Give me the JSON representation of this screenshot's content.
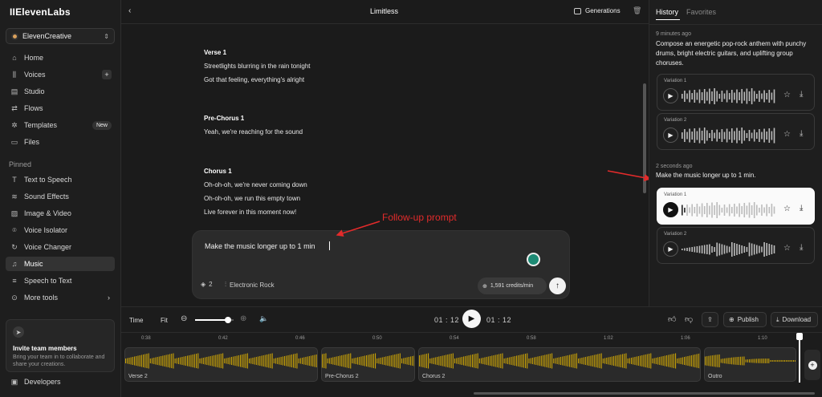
{
  "app": {
    "logo": "IIElevenLabs",
    "workspace": "ElevenCreative"
  },
  "sidebar": {
    "items": [
      {
        "label": "Home",
        "icon": "home-icon"
      },
      {
        "label": "Voices",
        "icon": "voices-icon",
        "extra": "+"
      },
      {
        "label": "Studio",
        "icon": "studio-icon"
      },
      {
        "label": "Flows",
        "icon": "flows-icon"
      },
      {
        "label": "Templates",
        "icon": "templates-icon",
        "badge": "New"
      },
      {
        "label": "Files",
        "icon": "files-icon"
      }
    ],
    "pinned_label": "Pinned",
    "pinned": [
      {
        "label": "Text to Speech",
        "icon": "tts-icon"
      },
      {
        "label": "Sound Effects",
        "icon": "sfx-icon"
      },
      {
        "label": "Image & Video",
        "icon": "image-icon"
      },
      {
        "label": "Voice Isolator",
        "icon": "isolator-icon"
      },
      {
        "label": "Voice Changer",
        "icon": "changer-icon"
      },
      {
        "label": "Music",
        "icon": "music-icon",
        "active": true
      },
      {
        "label": "Speech to Text",
        "icon": "stt-icon"
      },
      {
        "label": "More tools",
        "icon": "more-icon"
      }
    ],
    "invite": {
      "title": "Invite team members",
      "desc": "Bring your team in to collaborate and share your creations."
    },
    "developers": "Developers"
  },
  "topbar": {
    "title": "Limitless",
    "generations": "Generations"
  },
  "lyrics": [
    {
      "text": "Verse 1",
      "heading": true
    },
    {
      "text": "Streetlights blurring in the rain tonight"
    },
    {
      "text": "Got that feeling, everything's alright"
    },
    {
      "text": "Pre-Chorus 1",
      "heading": true
    },
    {
      "text": "Yeah, we're reaching for the sound"
    },
    {
      "text": "Chorus 1",
      "heading": true
    },
    {
      "text": "Oh-oh-oh, we're never coming down"
    },
    {
      "text": "Oh-oh-oh, we run this empty town"
    },
    {
      "text": "Live forever in this moment now!"
    }
  ],
  "prompt": {
    "value": "Make the music longer up to 1 min",
    "layers": "2",
    "genre": "Electronic Rock",
    "credits": "1,591 credits/min"
  },
  "annotations": {
    "followup": "Follow-up prompt"
  },
  "history": {
    "tabs": [
      "History",
      "Favorites"
    ],
    "groups": [
      {
        "time": "9 minutes ago",
        "prompt": "Compose an energetic pop-rock anthem with punchy drums, bright electric guitars, and uplifting group choruses.",
        "variations": [
          "Variation 1",
          "Variation 2"
        ]
      },
      {
        "time": "2 seconds ago",
        "prompt": "Make the music longer up to 1 min.",
        "variations": [
          "Variation 1",
          "Variation 2"
        ],
        "selected": 0
      }
    ]
  },
  "transport": {
    "time_label": "Time",
    "fit_label": "Fit",
    "current": "01 : 12",
    "total": "01 : 12",
    "zoom_level": 0.85,
    "publish": "Publish",
    "download": "Download"
  },
  "timeline": {
    "ticks": [
      "0:38",
      "0:42",
      "0:46",
      "0:50",
      "0:54",
      "0:58",
      "1:02",
      "1:06",
      "1:10"
    ],
    "segments": [
      "Verse 2",
      "Pre-Chorus 2",
      "Chorus 2",
      "Outro"
    ]
  },
  "colors": {
    "accent": "#e6b800",
    "annotation": "#e32b2b"
  }
}
